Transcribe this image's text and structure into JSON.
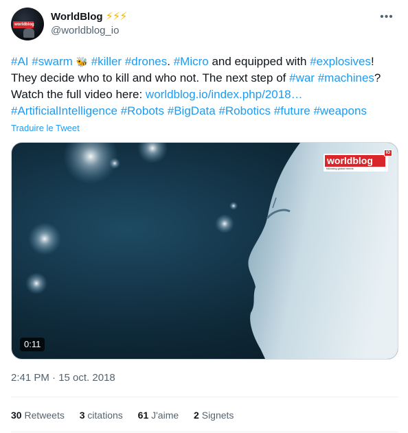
{
  "author": {
    "display_name": "WorldBlog",
    "bolts": "⚡⚡⚡",
    "handle": "@worldblog_io",
    "avatar_logo_text": "worldblog"
  },
  "more_icon": "•••",
  "tweet": {
    "line1": {
      "h_ai": "#AI",
      "h_swarm": "#swarm",
      "emoji": "🐝",
      "h_killer": "#killer",
      "h_drones": "#drones",
      "t1": ". ",
      "h_micro": "#Micro",
      "t2": " and equipped with ",
      "h_explosives": "#explosives",
      "t3": "!"
    },
    "line2": {
      "t1": "They decide who to kill and who not. The next step of ",
      "h_war": "#war",
      "h_machines": "#machines",
      "t2": "?"
    },
    "line3": {
      "t1": "Watch the full video here: ",
      "link": "worldblog.io/index.php/2018…"
    },
    "line4": {
      "h_ai2": "#ArtificialIntelligence",
      "h_robots": "#Robots",
      "h_bigdata": "#BigData",
      "h_robotics": "#Robotics",
      "h_future": "#future",
      "h_weapons": "#weapons"
    }
  },
  "translate_label": "Traduire le Tweet",
  "media": {
    "duration": "0:11",
    "logo_text": "worldblog",
    "logo_io": "IO",
    "logo_tagline": "following global trends"
  },
  "timestamp": "2:41 PM · 15 oct. 2018",
  "stats": {
    "retweets_count": "30",
    "retweets_label": "Retweets",
    "quotes_count": "3",
    "quotes_label": "citations",
    "likes_count": "61",
    "likes_label": "J'aime",
    "bookmarks_count": "2",
    "bookmarks_label": "Signets"
  },
  "colors": {
    "link": "#1d9bf0",
    "text": "#0f1419",
    "secondary": "#536471",
    "brand_red": "#d8262b",
    "bolt": "#f4b400"
  }
}
